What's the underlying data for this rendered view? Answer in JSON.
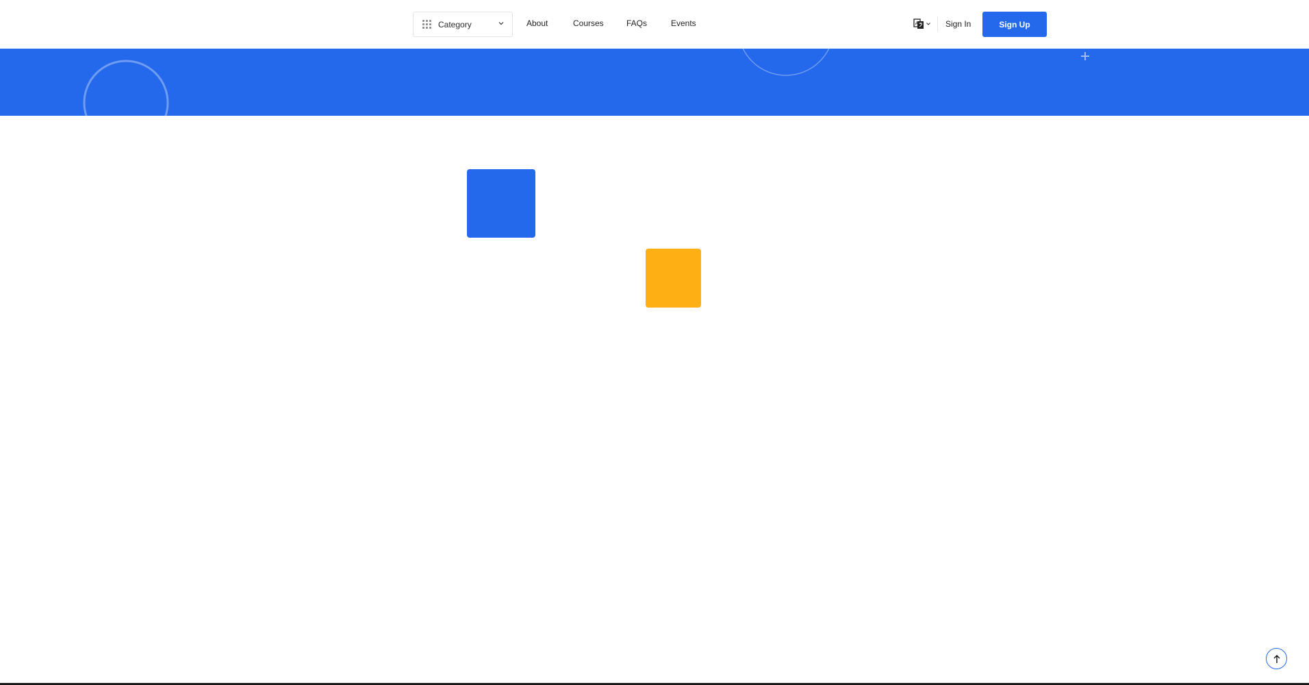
{
  "header": {
    "category": {
      "label": "Category",
      "icon": "grid-icon",
      "chevron": "chevron-down-icon"
    },
    "nav": [
      {
        "label": "About"
      },
      {
        "label": "Courses"
      },
      {
        "label": "FAQs"
      },
      {
        "label": "Events"
      }
    ],
    "language": {
      "icon": "translate-icon",
      "chevron": "chevron-down-icon"
    },
    "signin_label": "Sign In",
    "signup_label": "Sign Up"
  },
  "colors": {
    "primary": "#2469eb",
    "accent": "#feaf13",
    "text": "#1e1e1e"
  },
  "back_to_top": {
    "icon": "arrow-up-icon"
  }
}
